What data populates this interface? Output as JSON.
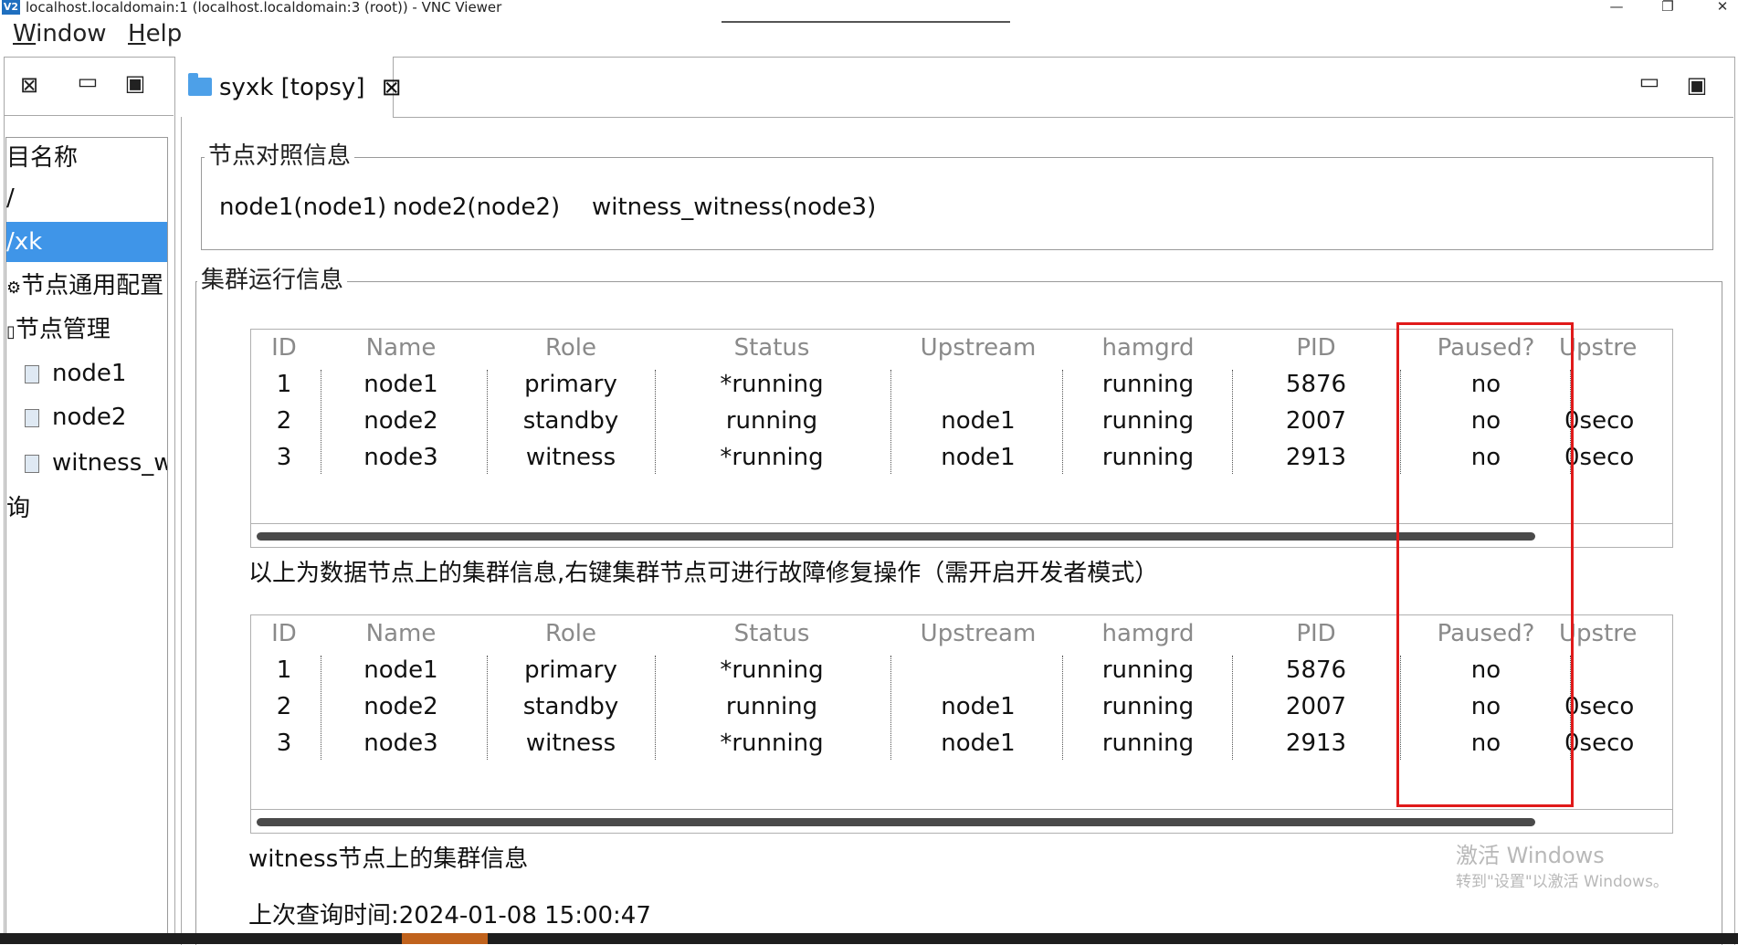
{
  "window": {
    "title": "localhost.localdomain:1 (localhost.localdomain:3 (root)) - VNC Viewer",
    "app_icon_text": "V2",
    "minimize_glyph": "—",
    "restore_glyph": "❐",
    "close_glyph": "✕"
  },
  "menu": {
    "items": [
      {
        "first": "W",
        "rest": "indow"
      },
      {
        "first": "H",
        "rest": "elp"
      }
    ]
  },
  "left_panel": {
    "icons": {
      "close": "⊠",
      "minimize": "▭",
      "maximize": "▣"
    },
    "tree": [
      {
        "label": "目名称",
        "selected": false,
        "icon": null
      },
      {
        "label": "/",
        "selected": false,
        "icon": null
      },
      {
        "label": "/xk",
        "selected": true,
        "icon": null
      },
      {
        "label": "节点通用配置",
        "selected": false,
        "icon": "gear-icon"
      },
      {
        "label": "节点管理",
        "selected": false,
        "icon": "folder-icon"
      },
      {
        "label": "node1",
        "selected": false,
        "icon": "file-icon"
      },
      {
        "label": "node2",
        "selected": false,
        "icon": "file-icon"
      },
      {
        "label": "witness_w",
        "selected": false,
        "icon": "file-icon"
      },
      {
        "label": "询",
        "selected": false,
        "icon": null
      }
    ]
  },
  "main_tab": {
    "label": "syxk [topsy]",
    "close_glyph": "⊠",
    "minimize_glyph": "▭",
    "maximize_glyph": "▣"
  },
  "node_mapping": {
    "title": "节点对照信息",
    "items": [
      "node1(node1)",
      "node2(node2)",
      "witness_witness(node3)"
    ]
  },
  "cluster_info": {
    "title": "集群运行信息",
    "columns": [
      "ID",
      "Name",
      "Role",
      "Status",
      "Upstream",
      "hamgrd",
      "PID",
      "Paused?",
      "Upstre"
    ],
    "data_table": [
      [
        "1",
        "node1",
        "primary",
        "*running",
        "",
        "running",
        "5876",
        "no",
        ""
      ],
      [
        "2",
        "node2",
        "standby",
        "running",
        "node1",
        "running",
        "2007",
        "no",
        "0seco"
      ],
      [
        "3",
        "node3",
        "witness",
        "*running",
        "node1",
        "running",
        "2913",
        "no",
        "0seco"
      ]
    ],
    "data_note": "以上为数据节点上的集群信息,右键集群节点可进行故障修复操作（需开启开发者模式）",
    "witness_table": [
      [
        "1",
        "node1",
        "primary",
        "*running",
        "",
        "running",
        "5876",
        "no",
        ""
      ],
      [
        "2",
        "node2",
        "standby",
        "running",
        "node1",
        "running",
        "2007",
        "no",
        "0seco"
      ],
      [
        "3",
        "node3",
        "witness",
        "*running",
        "node1",
        "running",
        "2913",
        "no",
        "0seco"
      ]
    ],
    "witness_note": "witness节点上的集群信息",
    "last_query": "上次查询时间:2024-01-08 15:00:47"
  },
  "watermark": {
    "line1": "激活 Windows",
    "line2": "转到\"设置\"以激活 Windows。"
  },
  "highlight_color": "#e01a1a",
  "selection_color": "#3f95e8"
}
